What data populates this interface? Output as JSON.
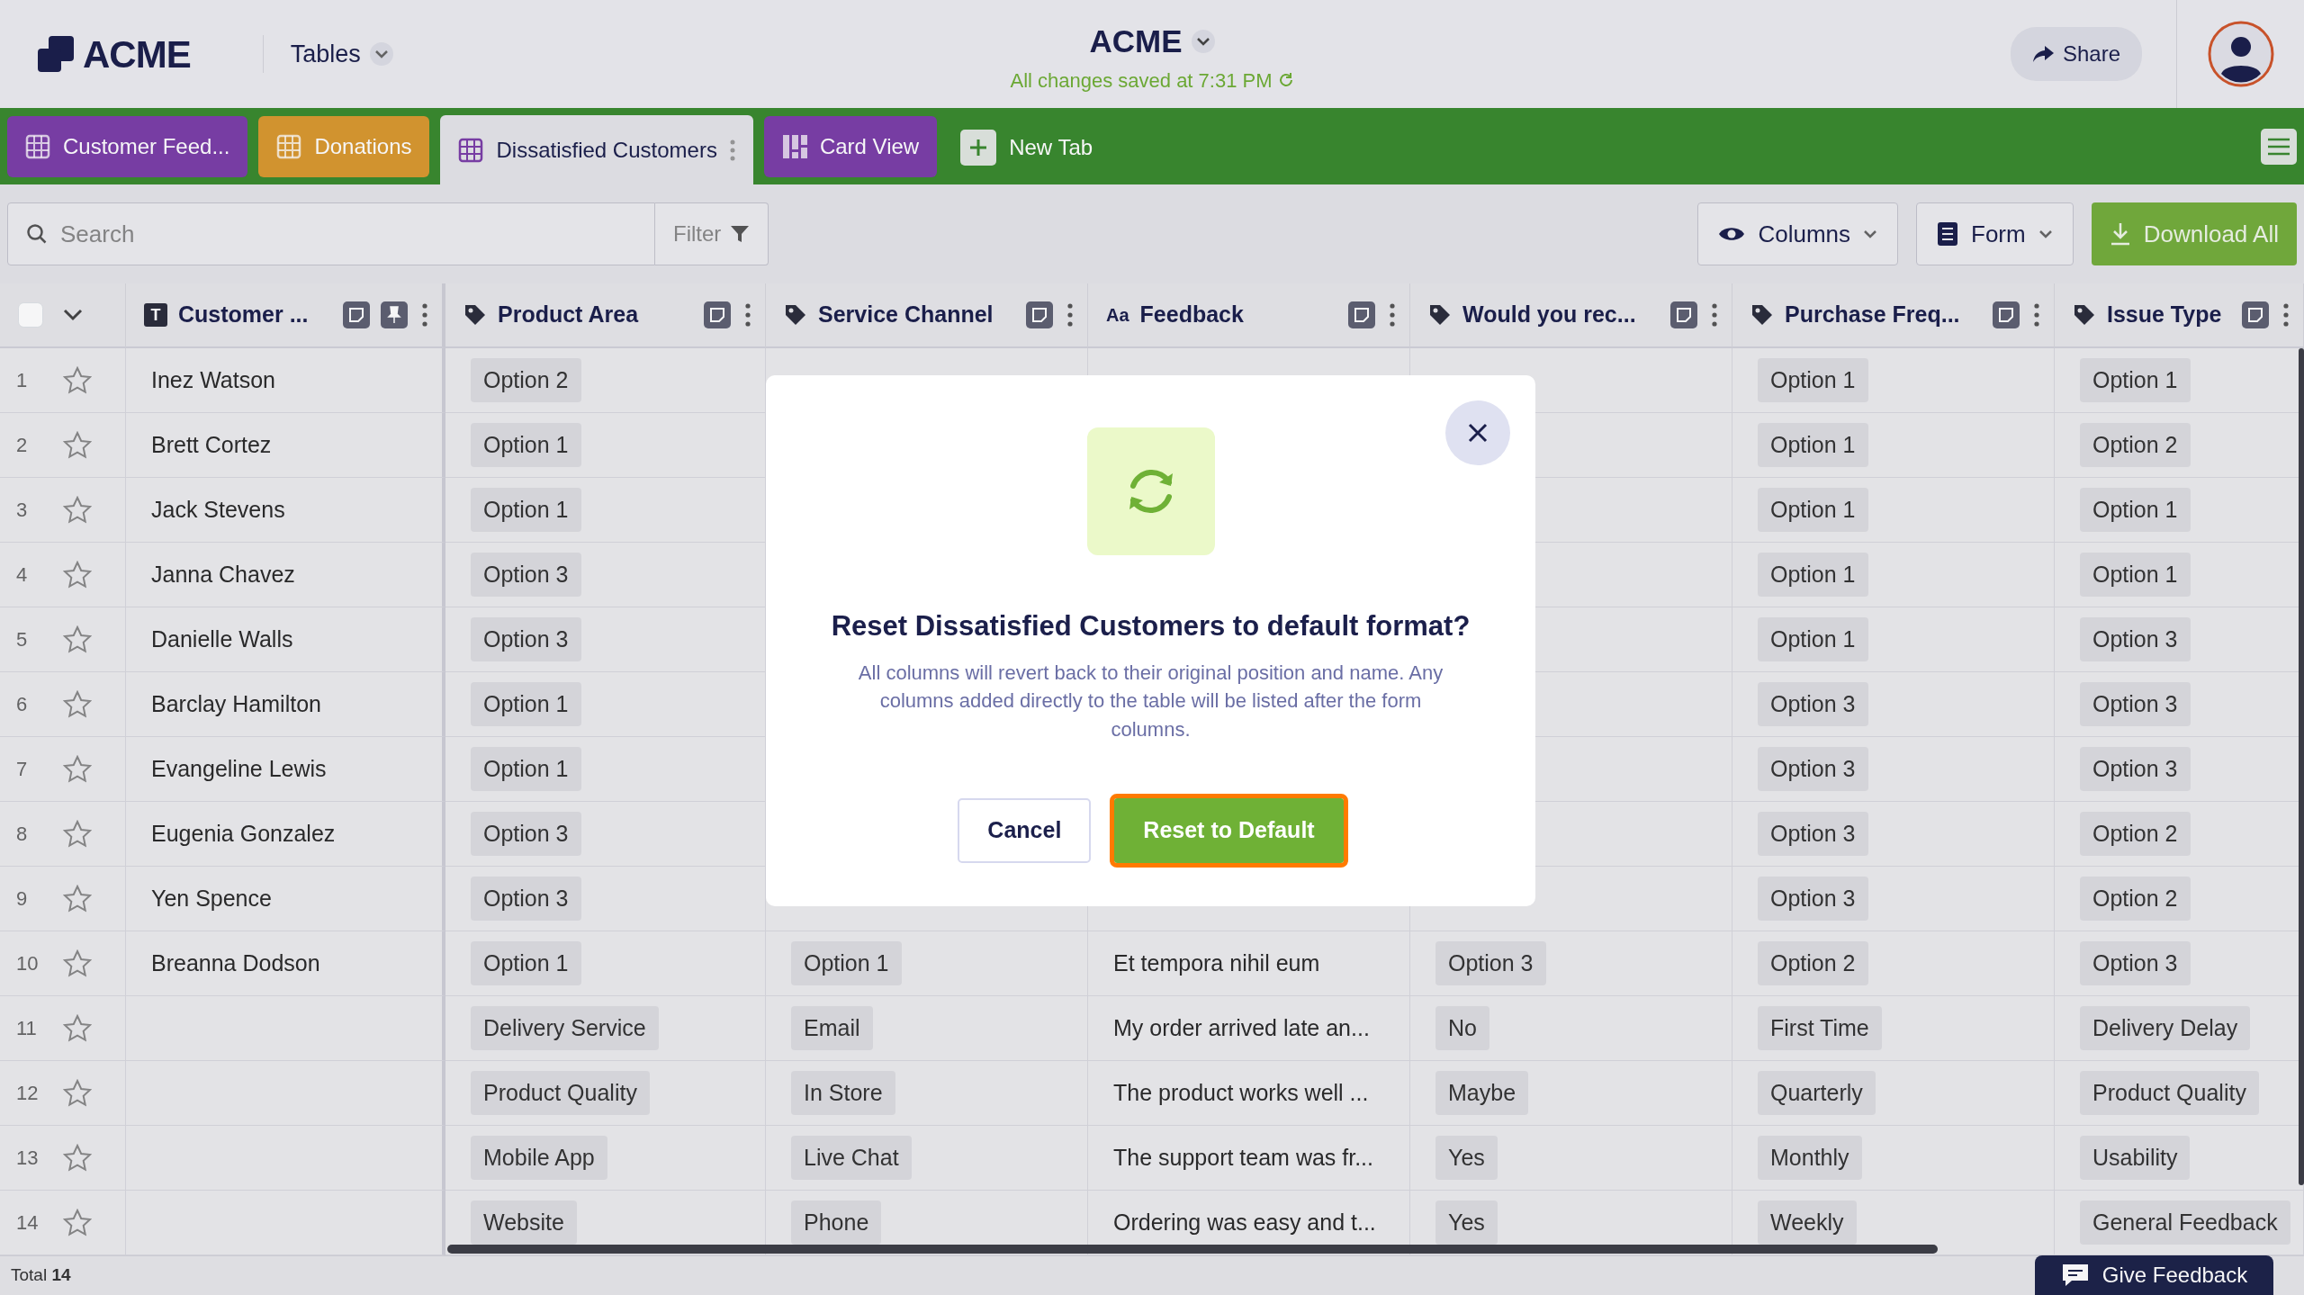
{
  "header": {
    "logo": "ACME",
    "menu": "Tables",
    "title": "ACME",
    "save_status": "All changes saved at 7:31 PM",
    "share": "Share"
  },
  "tabs": [
    {
      "label": "Customer Feed...",
      "kind": "table",
      "color": "#7b3fa8",
      "selected": false
    },
    {
      "label": "Donations",
      "kind": "table",
      "color": "#d9982f",
      "selected": false
    },
    {
      "label": "Dissatisfied Customers",
      "kind": "table",
      "color": "#7b3fa8",
      "selected": true
    },
    {
      "label": "Card View",
      "kind": "board",
      "color": "#7b3fa8",
      "selected": false
    }
  ],
  "new_tab": "New Tab",
  "toolbar": {
    "search_placeholder": "Search",
    "filter": "Filter",
    "columns": "Columns",
    "form": "Form",
    "download": "Download All"
  },
  "table": {
    "select_all_checked": false,
    "columns": [
      {
        "label": "Customer ...",
        "kind": "text",
        "icon_text": "T",
        "pinned": true
      },
      {
        "label": "Product Area",
        "kind": "select",
        "pinned": false
      },
      {
        "label": "Service Channel",
        "kind": "select",
        "pinned": false
      },
      {
        "label": "Feedback",
        "kind": "longtext",
        "icon_text": "Aa",
        "pinned": false
      },
      {
        "label": "Would you rec...",
        "kind": "select",
        "pinned": false
      },
      {
        "label": "Purchase Freq...",
        "kind": "select",
        "pinned": false
      },
      {
        "label": "Issue Type",
        "kind": "select",
        "pinned": false
      }
    ],
    "rows": [
      {
        "number": "1",
        "starred": false,
        "cells": [
          "Inez Watson",
          "Option 2",
          null,
          null,
          null,
          "Option 1",
          "Option 1"
        ]
      },
      {
        "number": "2",
        "starred": false,
        "cells": [
          "Brett Cortez",
          "Option 1",
          null,
          null,
          null,
          "Option 1",
          "Option 2"
        ]
      },
      {
        "number": "3",
        "starred": false,
        "cells": [
          "Jack Stevens",
          "Option 1",
          null,
          null,
          null,
          "Option 1",
          "Option 1"
        ]
      },
      {
        "number": "4",
        "starred": false,
        "cells": [
          "Janna Chavez",
          "Option 3",
          null,
          null,
          null,
          "Option 1",
          "Option 1"
        ]
      },
      {
        "number": "5",
        "starred": false,
        "cells": [
          "Danielle Walls",
          "Option 3",
          null,
          null,
          null,
          "Option 1",
          "Option 3"
        ]
      },
      {
        "number": "6",
        "starred": false,
        "cells": [
          "Barclay Hamilton",
          "Option 1",
          null,
          null,
          null,
          "Option 3",
          "Option 3"
        ]
      },
      {
        "number": "7",
        "starred": false,
        "cells": [
          "Evangeline Lewis",
          "Option 1",
          null,
          null,
          null,
          "Option 3",
          "Option 3"
        ]
      },
      {
        "number": "8",
        "starred": false,
        "cells": [
          "Eugenia Gonzalez",
          "Option 3",
          null,
          null,
          null,
          "Option 3",
          "Option 2"
        ]
      },
      {
        "number": "9",
        "starred": false,
        "cells": [
          "Yen Spence",
          "Option 3",
          null,
          null,
          null,
          "Option 3",
          "Option 2"
        ]
      },
      {
        "number": "10",
        "starred": false,
        "cells": [
          "Breanna Dodson",
          "Option 1",
          "Option 1",
          "Et tempora nihil eum",
          "Option 3",
          "Option 2",
          "Option 3"
        ]
      },
      {
        "number": "11",
        "starred": false,
        "cells": [
          null,
          "Delivery Service",
          "Email",
          "My order arrived late an...",
          "No",
          "First Time",
          "Delivery Delay"
        ]
      },
      {
        "number": "12",
        "starred": false,
        "cells": [
          null,
          "Product Quality",
          "In Store",
          "The product works well ...",
          "Maybe",
          "Quarterly",
          "Product Quality"
        ]
      },
      {
        "number": "13",
        "starred": false,
        "cells": [
          null,
          "Mobile App",
          "Live Chat",
          "The support team was fr...",
          "Yes",
          "Monthly",
          "Usability"
        ]
      },
      {
        "number": "14",
        "starred": false,
        "cells": [
          null,
          "Website",
          "Phone",
          "Ordering was easy and t...",
          "Yes",
          "Weekly",
          "General Feedback"
        ]
      }
    ]
  },
  "footer": {
    "total_label": "Total",
    "total": "14"
  },
  "feedback_button": "Give Feedback",
  "dialog": {
    "title": "Reset Dissatisfied Customers to default format?",
    "message": "All columns will revert back to their original position and name. Any columns added directly to the table will be listed after the form columns.",
    "cancel": "Cancel",
    "confirm": "Reset to Default",
    "confirm_focused": true
  }
}
